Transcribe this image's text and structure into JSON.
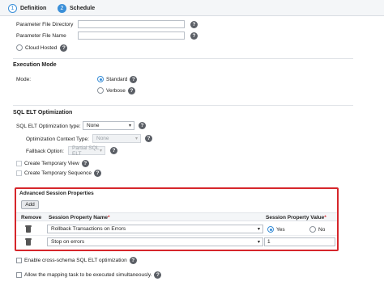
{
  "tabs": [
    {
      "num": "1",
      "label": "Definition"
    },
    {
      "num": "2",
      "label": "Schedule"
    }
  ],
  "param_file_directory_label": "Parameter File Directory",
  "param_file_name_label": "Parameter File Name",
  "cloud_hosted_label": "Cloud Hosted",
  "execution_mode": {
    "title": "Execution Mode",
    "mode_label": "Mode:",
    "standard_label": "Standard",
    "verbose_label": "Verbose",
    "selected": "Standard"
  },
  "sql_elt": {
    "title": "SQL ELT Optimization",
    "type_label": "SQL ELT Optimization type:",
    "type_value": "None",
    "context_label": "Optimization Context Type:",
    "context_value": "None",
    "fallback_label": "Fallback Option:",
    "fallback_value": "Partial SQL ELT",
    "create_view_label": "Create Temporary View",
    "create_sequence_label": "Create Temporary Sequence"
  },
  "advanced": {
    "title": "Advanced Session Properties",
    "add_label": "Add",
    "col_remove": "Remove",
    "col_name": "Session Property Name",
    "col_value": "Session Property Value",
    "required_mark": "*",
    "rows": [
      {
        "name": "Rollback Transactions on Errors",
        "yes_label": "Yes",
        "no_label": "No",
        "selected": "Yes"
      },
      {
        "name": "Stop on errors",
        "value": "1"
      }
    ]
  },
  "cross_schema_label": "Enable cross-schema SQL ELT optimization",
  "simultaneous_label": "Allow the mapping task to be executed simultaneously.",
  "help_glyph": "?",
  "caret_glyph": "▾",
  "accent_color": "#3a8fd8",
  "highlight_color": "#d6262b"
}
